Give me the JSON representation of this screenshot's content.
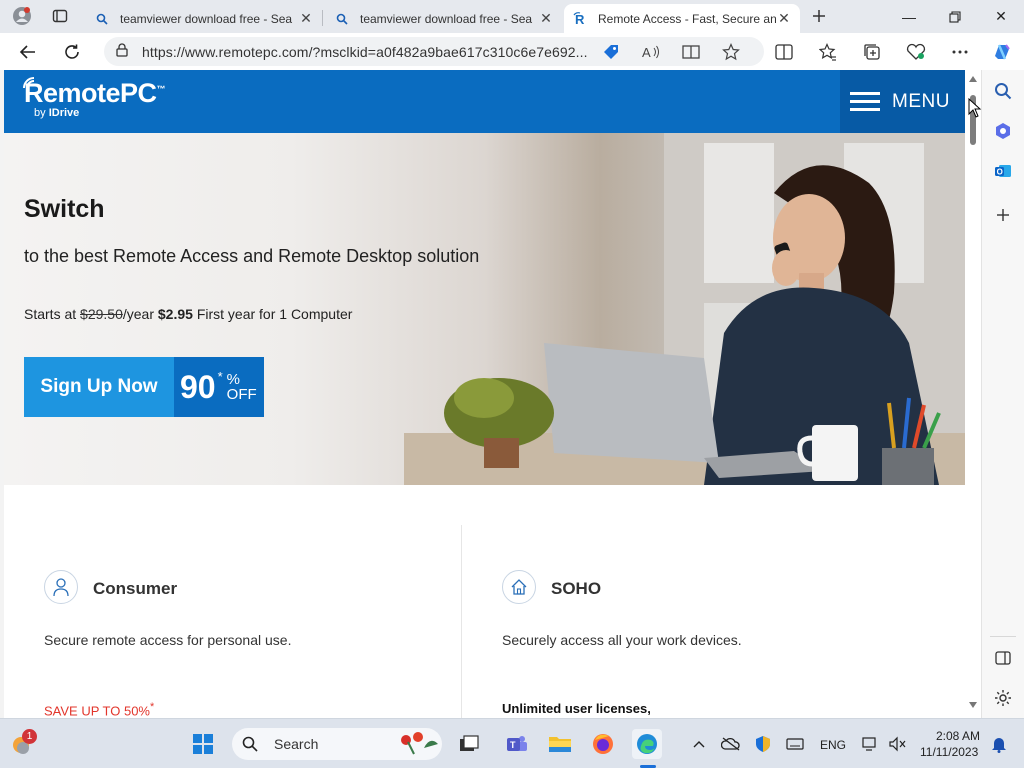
{
  "browser": {
    "tabs": [
      {
        "title": "teamviewer download free - Sea",
        "active": false
      },
      {
        "title": "teamviewer download free - Sea",
        "active": false
      },
      {
        "title": "Remote Access - Fast, Secure and",
        "active": true
      }
    ],
    "url": "https://www.remotepc.com/?msclkid=a0f482a9bae617c310c6e7e692..."
  },
  "site": {
    "brand": "RemotePC",
    "brand_tm": "™",
    "by_prefix": "by",
    "by_name": "IDrive",
    "menu_label": "MENU"
  },
  "hero": {
    "title": "Switch",
    "subtitle": "to the best Remote Access and Remote Desktop solution",
    "price_prefix": "Starts at",
    "old_price": "$29.50",
    "per_year": "/year",
    "new_price": "$2.95",
    "price_suffix": "First year for 1 Computer",
    "cta_label": "Sign Up Now",
    "discount": "90",
    "discount_star": "*",
    "discount_pct": "%",
    "discount_off": "OFF"
  },
  "plans": [
    {
      "title": "Consumer",
      "description": "Secure remote access for personal use.",
      "extra": "SAVE UP TO 50%",
      "extra_star": "*",
      "icon": "user-icon"
    },
    {
      "title": "SOHO",
      "description": "Securely access all your work devices.",
      "extra": "Unlimited user licenses,",
      "icon": "home-icon"
    }
  ],
  "taskbar": {
    "search_label": "Search",
    "notification_count": "1",
    "lang": "ENG",
    "time": "2:08 AM",
    "date": "11/11/2023"
  },
  "colors": {
    "brand_blue": "#0a6cc0",
    "cta_blue": "#1e95e0",
    "save_red": "#e2352b"
  }
}
